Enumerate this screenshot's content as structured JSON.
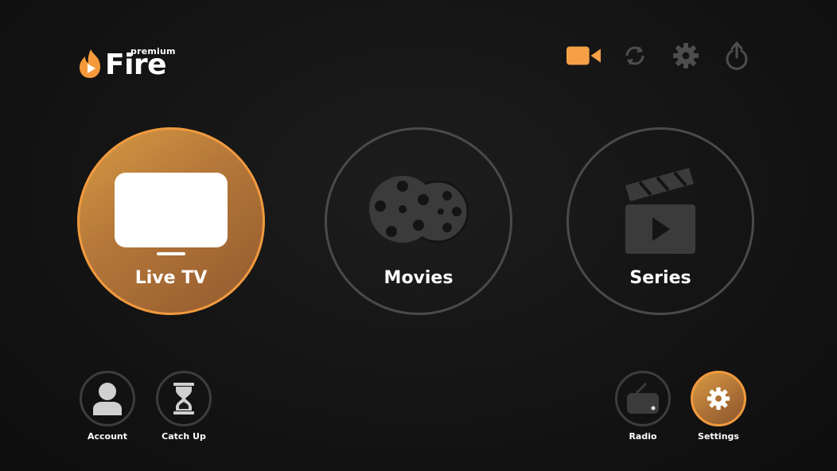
{
  "app": {
    "logo_small": "premium",
    "logo_main": "Fire",
    "brand_color": "#f19a3e"
  },
  "toolbar": {
    "items": [
      {
        "icon": "video-camera-icon",
        "active": true
      },
      {
        "icon": "refresh-icon",
        "active": false
      },
      {
        "icon": "gear-icon",
        "active": false
      },
      {
        "icon": "power-icon",
        "active": false
      }
    ]
  },
  "tiles": [
    {
      "label": "Live TV",
      "icon": "tv-icon",
      "active": true
    },
    {
      "label": "Movies",
      "icon": "film-reel-icon",
      "active": false
    },
    {
      "label": "Series",
      "icon": "clapperboard-icon",
      "active": false
    }
  ],
  "shortcuts": [
    {
      "label": "Account",
      "icon": "user-icon",
      "active": false
    },
    {
      "label": "Catch Up",
      "icon": "hourglass-icon",
      "active": false
    },
    {
      "label": "Radio",
      "icon": "radio-icon",
      "active": false
    },
    {
      "label": "Settings",
      "icon": "gear-icon",
      "active": true
    }
  ]
}
